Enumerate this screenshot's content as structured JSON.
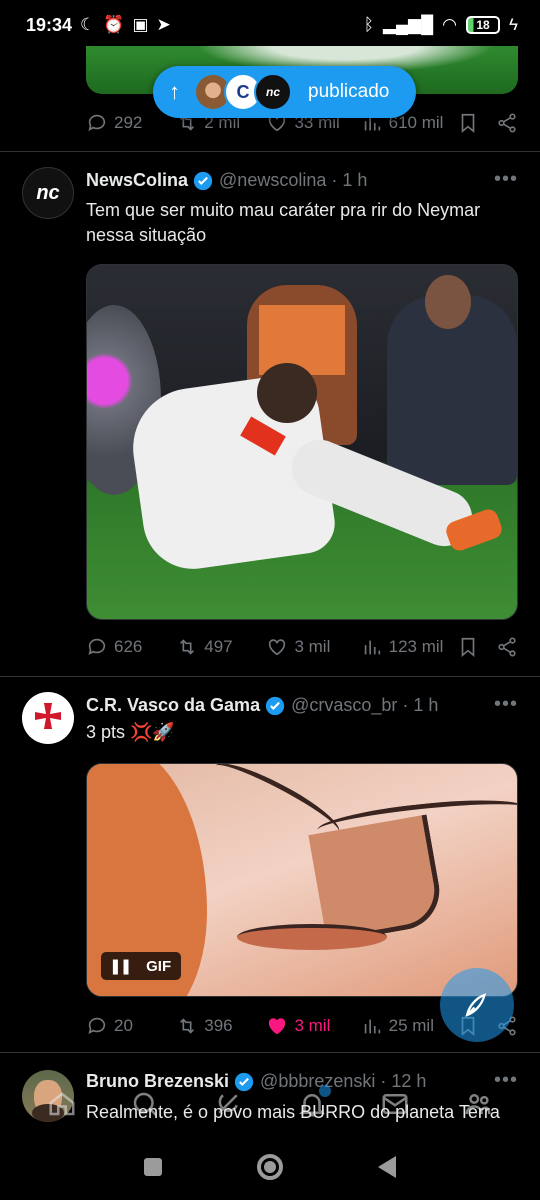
{
  "status_bar": {
    "time": "19:34",
    "left_icons": [
      "moon-icon",
      "alarm-icon",
      "sim-icon",
      "telegram-icon"
    ],
    "right_icons": [
      "bluetooth-icon",
      "signal-icon",
      "wifi-icon"
    ],
    "battery": "18"
  },
  "new_posts_pill": {
    "label": "publicado"
  },
  "top_tweet_actions": {
    "replies": "292",
    "reposts": "2 mil",
    "likes": "33 mil",
    "views": "610 mil"
  },
  "tweets": [
    {
      "name": "NewsColina",
      "handle": "@newscolina",
      "separator": "·",
      "time": "1 h",
      "text": "Tem que ser muito mau caráter pra rir do Neymar nessa situação",
      "avatar_text": "nc",
      "replies": "626",
      "reposts": "497",
      "likes": "3 mil",
      "views": "123 mil"
    },
    {
      "name": "C.R. Vasco da Gama",
      "handle": "@crvasco_br",
      "separator": "·",
      "time": "1 h",
      "text": "3 pts 💢🚀",
      "media_label": "GIF",
      "replies": "20",
      "reposts": "396",
      "likes": "3 mil",
      "views": "25 mil"
    },
    {
      "name": "Bruno Brezenski",
      "handle": "@bbbrezenski",
      "separator": "·",
      "time": "12 h",
      "text": "Realmente, é o povo mais BURRO do planeta Terra"
    }
  ],
  "colors": {
    "accent": "#1d9bf0",
    "like": "#f91880",
    "muted": "#71767b",
    "background": "#000000"
  }
}
